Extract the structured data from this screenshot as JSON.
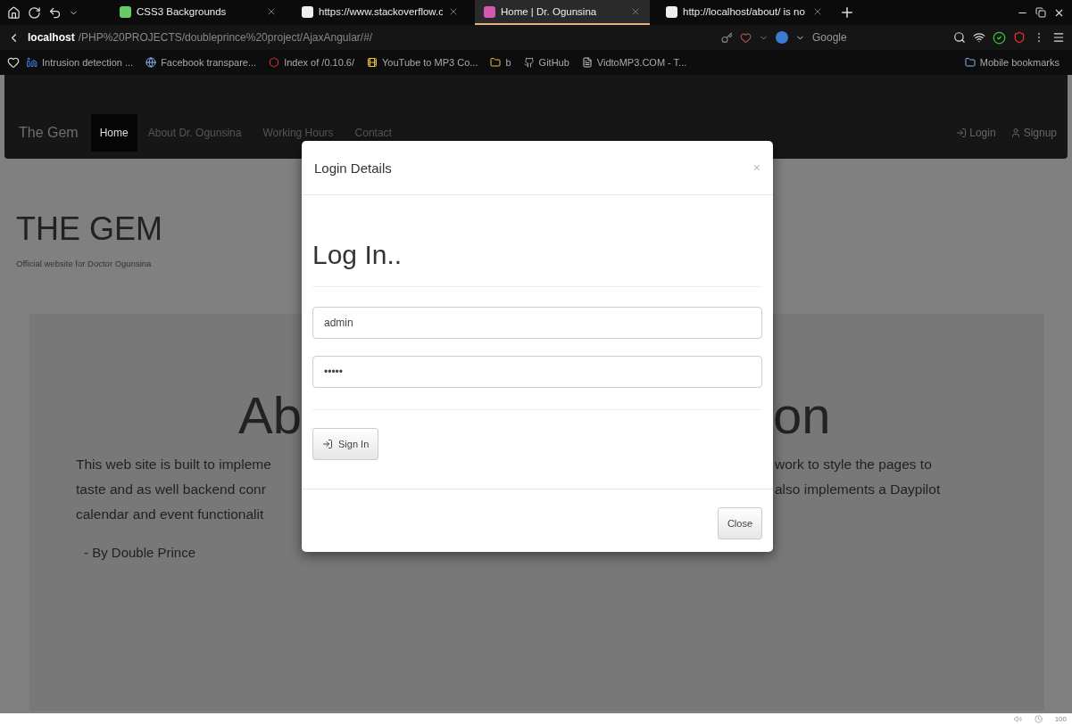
{
  "browser": {
    "tabs": [
      {
        "label": "CSS3 Backgrounds",
        "selected": false
      },
      {
        "label": "https://www.stackoverflow.c",
        "selected": false
      },
      {
        "label": "Home | Dr. Ogunsina",
        "selected": true
      },
      {
        "label": "http://localhost/about/ is no",
        "selected": false
      }
    ],
    "address": {
      "host": "localhost",
      "path": "/PHP%20PROJECTS/doubleprince%20project/AjaxAngular/#/"
    },
    "search_engine": "Google",
    "bookmarks": [
      "Intrusion detection ...",
      "Facebook transpare...",
      "Index of /0.10.6/",
      "YouTube to MP3 Co...",
      "b",
      "GitHub",
      "VidtoMP3.COM - T..."
    ],
    "mobile_bookmarks": "Mobile bookmarks"
  },
  "navbar": {
    "brand": "The Gem",
    "items": [
      {
        "label": "Home",
        "selected": true
      },
      {
        "label": "About Dr. Ogunsina",
        "selected": false
      },
      {
        "label": "Working Hours",
        "selected": false
      },
      {
        "label": "Contact",
        "selected": false
      }
    ],
    "right_items": [
      "Login",
      "Signup"
    ]
  },
  "header": {
    "title": "THE GEM",
    "subtitle": "Official website for Doctor Ogunsina"
  },
  "jumbotron": {
    "heading_left": "Ab",
    "heading_right": "on",
    "lines": [
      {
        "left": "This web site is built to impleme",
        "right": "work to style the pages to"
      },
      {
        "left": "taste and as well backend conr",
        "right": "also implements a Daypilot"
      },
      {
        "left": "calendar and event functionalit"
      }
    ],
    "signature": "- By Double Prince"
  },
  "modal": {
    "title": "Login Details",
    "close_icon": "×",
    "heading": "Log In..",
    "username": "admin",
    "password": "•••••",
    "submit": "Sign In",
    "footer_button": "Close"
  },
  "status_bar": {
    "zoom": "100"
  }
}
